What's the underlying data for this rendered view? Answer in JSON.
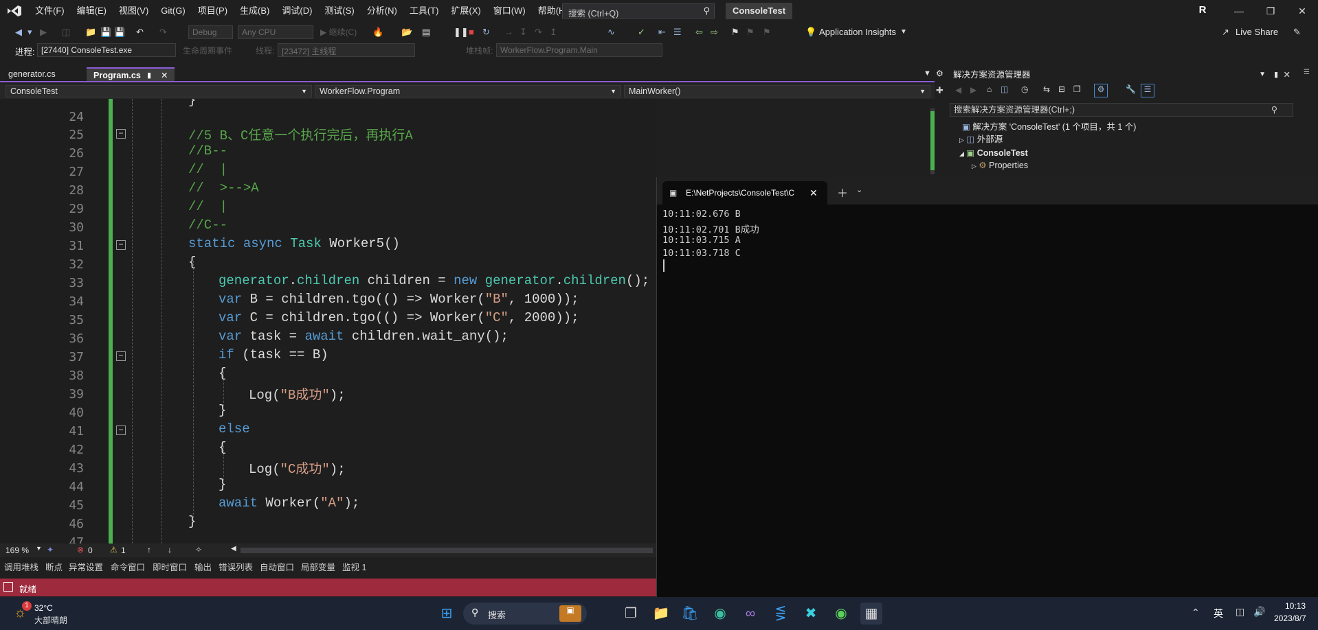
{
  "app": {
    "menus": [
      "文件(F)",
      "编辑(E)",
      "视图(V)",
      "Git(G)",
      "项目(P)",
      "生成(B)",
      "调试(D)",
      "测试(S)",
      "分析(N)",
      "工具(T)",
      "扩展(X)",
      "窗口(W)",
      "帮助(H)"
    ],
    "search_placeholder": "搜索 (Ctrl+Q)",
    "solution_name": "ConsoleTest",
    "avatar_initial": "R"
  },
  "toolbar": {
    "config": "Debug",
    "platform": "Any CPU",
    "continue_label": "继续(C)",
    "app_insights": "Application Insights",
    "live_share": "Live Share"
  },
  "debug_toolbar": {
    "process_label": "进程:",
    "process_value": "[27440] ConsoleTest.exe",
    "lifecycle_label": "生命周期事件",
    "thread_label": "线程:",
    "thread_value": "[23472] 主线程",
    "stack_label": "堆栈帧:",
    "stack_value": "WorkerFlow.Program.Main"
  },
  "tabs": [
    {
      "label": "generator.cs"
    },
    {
      "label": "Program.cs"
    }
  ],
  "nav": {
    "project": "ConsoleTest",
    "class": "WorkerFlow.Program",
    "member": "MainWorker()"
  },
  "editor": {
    "line_numbers": [
      "24",
      "25",
      "26",
      "27",
      "28",
      "29",
      "30",
      "31",
      "32",
      "33",
      "34",
      "35",
      "36",
      "37",
      "38",
      "39",
      "40",
      "41",
      "42",
      "43",
      "44",
      "45",
      "46",
      "47"
    ]
  },
  "status": {
    "zoom": "169 %",
    "errors": "0",
    "warnings": "1",
    "ready": "就绪"
  },
  "bottom_tabs": [
    "调用堆栈",
    "断点",
    "异常设置",
    "命令窗口",
    "即时窗口",
    "输出",
    "错误列表",
    "自动窗口",
    "局部变量",
    "监视 1"
  ],
  "solution_explorer": {
    "title": "解决方案资源管理器",
    "search": "搜索解决方案资源管理器(Ctrl+;)",
    "solution": "解决方案 'ConsoleTest' (1 个项目，共 1 个)",
    "external": "外部源",
    "project": "ConsoleTest",
    "properties": "Properties"
  },
  "terminal": {
    "tab_title": "E:\\NetProjects\\ConsoleTest\\C",
    "output": [
      "10:11:02.676 B",
      "10:11:02.701 B成功",
      "10:11:03.715 A",
      "10:11:03.718 C"
    ]
  },
  "taskbar": {
    "weather_temp": "32°C",
    "weather_desc": "大部晴朗",
    "weather_badge": "1",
    "search": "搜索",
    "ime": "英",
    "time": "10:13",
    "date": "2023/8/7"
  }
}
